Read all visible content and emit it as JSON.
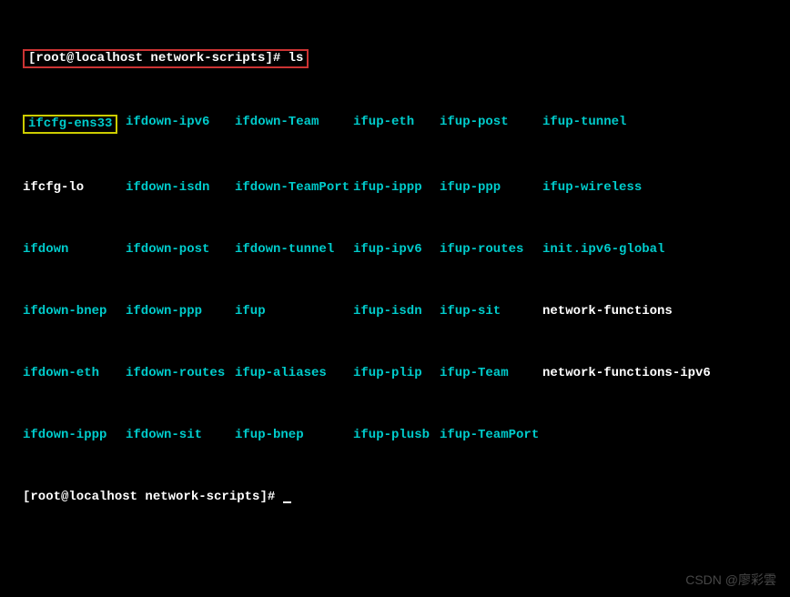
{
  "prompt1": "[root@localhost network-scripts]# ls",
  "prompt2": "[root@localhost network-scripts]# ",
  "highlighted_file": "ifcfg-ens33",
  "files": {
    "row0": [
      {
        "t": "ifcfg-ens33",
        "c": "cyan",
        "hl": true
      },
      {
        "t": "ifdown-ipv6",
        "c": "cyan"
      },
      {
        "t": "ifdown-Team",
        "c": "cyan"
      },
      {
        "t": "ifup-eth",
        "c": "cyan"
      },
      {
        "t": "ifup-post",
        "c": "cyan"
      },
      {
        "t": "ifup-tunnel",
        "c": "cyan"
      }
    ],
    "row1": [
      {
        "t": "ifcfg-lo",
        "c": "white"
      },
      {
        "t": "ifdown-isdn",
        "c": "cyan"
      },
      {
        "t": "ifdown-TeamPort",
        "c": "cyan"
      },
      {
        "t": "ifup-ippp",
        "c": "cyan"
      },
      {
        "t": "ifup-ppp",
        "c": "cyan"
      },
      {
        "t": "ifup-wireless",
        "c": "cyan"
      }
    ],
    "row2": [
      {
        "t": "ifdown",
        "c": "cyan"
      },
      {
        "t": "ifdown-post",
        "c": "cyan"
      },
      {
        "t": "ifdown-tunnel",
        "c": "cyan"
      },
      {
        "t": "ifup-ipv6",
        "c": "cyan"
      },
      {
        "t": "ifup-routes",
        "c": "cyan"
      },
      {
        "t": "init.ipv6-global",
        "c": "cyan"
      }
    ],
    "row3": [
      {
        "t": "ifdown-bnep",
        "c": "cyan"
      },
      {
        "t": "ifdown-ppp",
        "c": "cyan"
      },
      {
        "t": "ifup",
        "c": "cyan"
      },
      {
        "t": "ifup-isdn",
        "c": "cyan"
      },
      {
        "t": "ifup-sit",
        "c": "cyan"
      },
      {
        "t": "network-functions",
        "c": "white"
      }
    ],
    "row4": [
      {
        "t": "ifdown-eth",
        "c": "cyan"
      },
      {
        "t": "ifdown-routes",
        "c": "cyan"
      },
      {
        "t": "ifup-aliases",
        "c": "cyan"
      },
      {
        "t": "ifup-plip",
        "c": "cyan"
      },
      {
        "t": "ifup-Team",
        "c": "cyan"
      },
      {
        "t": "network-functions-ipv6",
        "c": "white"
      }
    ],
    "row5": [
      {
        "t": "ifdown-ippp",
        "c": "cyan"
      },
      {
        "t": "ifdown-sit",
        "c": "cyan"
      },
      {
        "t": "ifup-bnep",
        "c": "cyan"
      },
      {
        "t": "ifup-plusb",
        "c": "cyan"
      },
      {
        "t": "ifup-TeamPort",
        "c": "cyan"
      },
      {
        "t": "",
        "c": "white"
      }
    ]
  },
  "watermark": "CSDN @廖彩雲"
}
